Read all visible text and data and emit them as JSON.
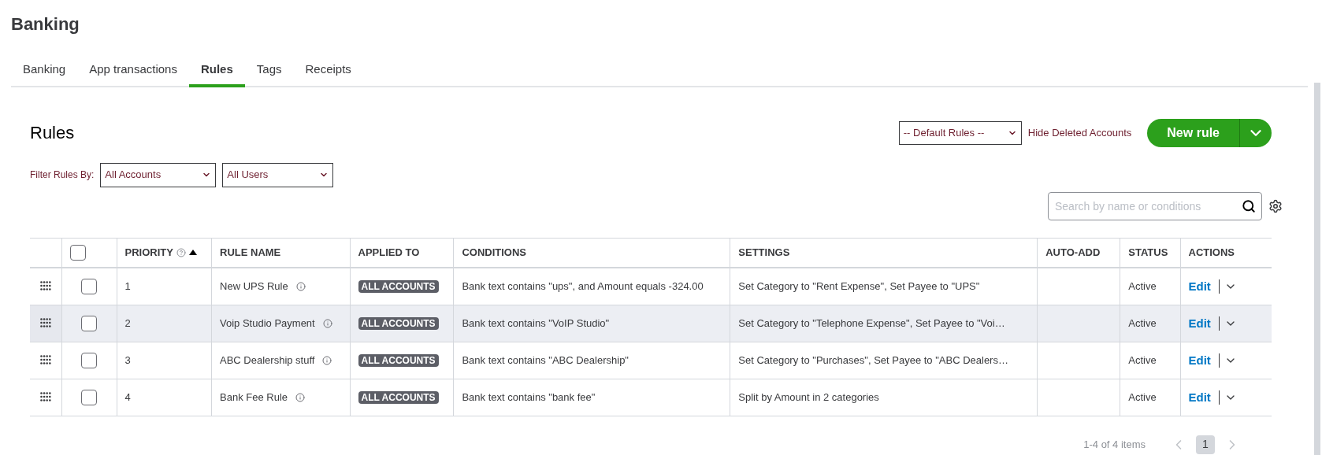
{
  "page_title": "Banking",
  "tabs": [
    {
      "label": "Banking",
      "selected": false
    },
    {
      "label": "App transactions",
      "selected": false
    },
    {
      "label": "Rules",
      "selected": true
    },
    {
      "label": "Tags",
      "selected": false
    },
    {
      "label": "Receipts",
      "selected": false
    }
  ],
  "section_title": "Rules",
  "default_rules_select": "-- Default Rules --",
  "hide_deleted_link": "Hide Deleted Accounts",
  "new_rule_button": "New rule",
  "filter": {
    "label": "Filter Rules By:",
    "accounts": "All Accounts",
    "users": "All Users"
  },
  "search": {
    "placeholder": "Search by name or conditions"
  },
  "table": {
    "select_all_checked": false,
    "columns": [
      "PRIORITY",
      "RULE NAME",
      "APPLIED TO",
      "CONDITIONS",
      "SETTINGS",
      "AUTO-ADD",
      "STATUS",
      "ACTIONS"
    ],
    "rows": [
      {
        "priority": "1",
        "name": "New UPS Rule",
        "applied_to": "ALL ACCOUNTS",
        "conditions": "Bank text contains \"ups\", and Amount equals -324.00",
        "settings": "Set Category to \"Rent Expense\", Set Payee to \"UPS\"",
        "status": "Active",
        "action": "Edit",
        "checked": false,
        "highlighted": false
      },
      {
        "priority": "2",
        "name": "Voip Studio Payment",
        "applied_to": "ALL ACCOUNTS",
        "conditions": "Bank text contains \"VoIP Studio\"",
        "settings": "Set Category to \"Telephone Expense\", Set Payee to \"Voi…",
        "status": "Active",
        "action": "Edit",
        "checked": false,
        "highlighted": true
      },
      {
        "priority": "3",
        "name": "ABC Dealership stuff",
        "applied_to": "ALL ACCOUNTS",
        "conditions": "Bank text contains \"ABC Dealership\"",
        "settings": "Set Category to \"Purchases\", Set Payee to \"ABC Dealers…",
        "status": "Active",
        "action": "Edit",
        "checked": false,
        "highlighted": false
      },
      {
        "priority": "4",
        "name": "Bank Fee Rule",
        "applied_to": "ALL ACCOUNTS",
        "conditions": "Bank text contains \"bank fee\"",
        "settings": "Split by Amount in 2 categories",
        "status": "Active",
        "action": "Edit",
        "checked": false,
        "highlighted": false
      }
    ]
  },
  "pagination": {
    "summary": "1-4 of 4 items",
    "pages": [
      {
        "label": "1",
        "selected": true
      }
    ]
  }
}
